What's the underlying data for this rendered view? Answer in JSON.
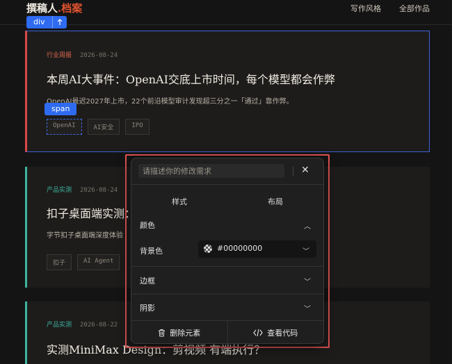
{
  "header": {
    "brand_main": "撰稿人",
    "brand_dot": ".",
    "brand_accent": "档案",
    "nav": [
      "写作风格",
      "全部作品"
    ]
  },
  "selection": {
    "div_label": "div",
    "up_icon": "arrow-up-icon",
    "span_label": "span"
  },
  "cards": [
    {
      "category": "行业周报",
      "date": "2026-08-24",
      "title": "本周AI大事件：OpenAI交底上市时间，每个模型都会作弊",
      "desc": "OpenAI最迟2027年上市，22个前沿模型审计发现超三分之一「通过」靠作弊。",
      "tags": [
        "OpenAI",
        "AI安全",
        "IPO"
      ]
    },
    {
      "category": "产品实测",
      "date": "2026-08-24",
      "title": "扣子桌面端实测：",
      "desc": "字节扣子桌面端深度体验",
      "tags": [
        "扣子",
        "AI Agent"
      ]
    },
    {
      "category": "产品实测",
      "date": "2026-08-22",
      "title": "实测MiniMax Design：剪视频 有端执行？"
    }
  ],
  "panel": {
    "placeholder": "请描述你的修改需求",
    "close_icon": "close-icon",
    "tabs": [
      "样式",
      "布局"
    ],
    "color_section": "颜色",
    "bg_label": "背景色",
    "bg_value": "#00000000",
    "border_section": "边框",
    "shadow_section": "阴影",
    "delete_label": "删除元素",
    "code_label": "查看代码",
    "colors": {
      "accent": "#2f6bf0",
      "highlight": "#e55454",
      "red": "#d94848",
      "teal": "#3fb59f"
    }
  }
}
